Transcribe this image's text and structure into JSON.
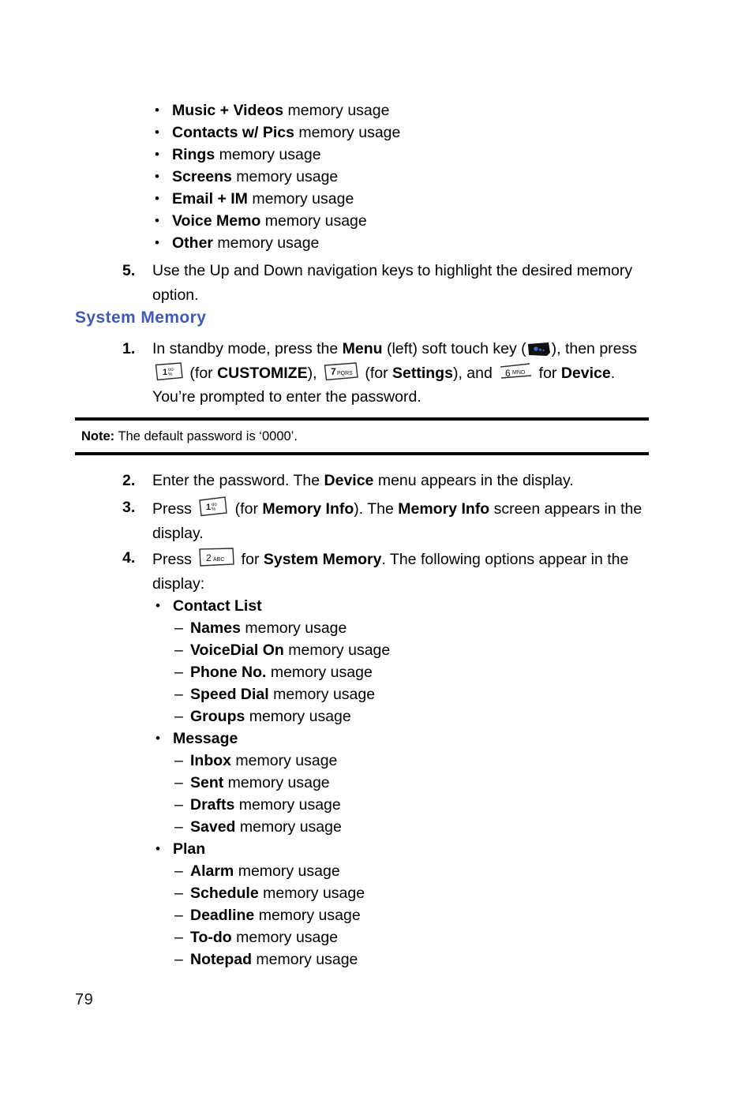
{
  "page": {
    "number": "79"
  },
  "top_list": {
    "items": [
      {
        "bold": "Music + Videos",
        "rest": " memory usage"
      },
      {
        "bold": "Contacts w/ Pics",
        "rest": " memory usage"
      },
      {
        "bold": "Rings",
        "rest": " memory usage"
      },
      {
        "bold": "Screens",
        "rest": " memory usage"
      },
      {
        "bold": "Email + IM",
        "rest": " memory usage"
      },
      {
        "bold": "Voice Memo",
        "rest": " memory usage"
      },
      {
        "bold": "Other",
        "rest": " memory usage"
      }
    ]
  },
  "step5": {
    "number": "5.",
    "text": "Use the Up and Down navigation keys to highlight the desired memory option."
  },
  "heading": {
    "label": "System Memory",
    "color": "#4059b8"
  },
  "step1": {
    "number": "1.",
    "part1": "In standby mode, press the ",
    "bold1": "Menu",
    "part2": " (left) soft touch key (",
    "part3": "), then press ",
    "part4": " (for ",
    "bold2": "CUSTOMIZE",
    "part5": "), ",
    "part6": " (for ",
    "bold3": "Settings",
    "part7": "), and ",
    "part8": " for ",
    "bold4": "Device",
    "part9": ". You’re prompted to enter the password."
  },
  "keys": {
    "one": {
      "digit": "1",
      "letters": "∞⌘"
    },
    "two": {
      "digit": "2",
      "letters": "ABC"
    },
    "six": {
      "digit": "6",
      "letters": "MNO"
    },
    "seven": {
      "digit": "7",
      "letters": "PQRS"
    },
    "softkey_name": "menu-soft-touch-key"
  },
  "note": {
    "label": "Note:",
    "text": " The default password is ‘0000’."
  },
  "step2": {
    "number": "2.",
    "part1": "Enter the password. The ",
    "bold1": "Device",
    "part2": " menu appears in the display."
  },
  "step3": {
    "number": "3.",
    "part1": "Press ",
    "part2": " (for ",
    "bold1": "Memory Info",
    "part3": "). The ",
    "bold2": "Memory Info",
    "part4": " screen appears in the display."
  },
  "step4": {
    "number": "4.",
    "part1": "Press ",
    "part2": " for ",
    "bold1": "System Memory",
    "part3": ". The following options appear in the display:"
  },
  "options": [
    {
      "label": "Contact List",
      "subitems": [
        {
          "bold": "Names",
          "rest": " memory usage"
        },
        {
          "bold": "VoiceDial On",
          "rest": " memory usage"
        },
        {
          "bold": "Phone No.",
          "rest": " memory usage"
        },
        {
          "bold": "Speed Dial",
          "rest": " memory usage"
        },
        {
          "bold": "Groups",
          "rest": " memory usage"
        }
      ]
    },
    {
      "label": "Message",
      "subitems": [
        {
          "bold": "Inbox",
          "rest": " memory usage"
        },
        {
          "bold": "Sent",
          "rest": " memory usage"
        },
        {
          "bold": "Drafts",
          "rest": " memory usage"
        },
        {
          "bold": "Saved",
          "rest": " memory usage"
        }
      ]
    },
    {
      "label": "Plan",
      "subitems": [
        {
          "bold": "Alarm",
          "rest": " memory usage"
        },
        {
          "bold": "Schedule",
          "rest": " memory usage"
        },
        {
          "bold": "Deadline",
          "rest": " memory usage"
        },
        {
          "bold": "To-do",
          "rest": " memory usage"
        },
        {
          "bold": "Notepad",
          "rest": " memory usage"
        }
      ]
    }
  ],
  "glyphs": {
    "bullet": "•",
    "dash": "–"
  }
}
